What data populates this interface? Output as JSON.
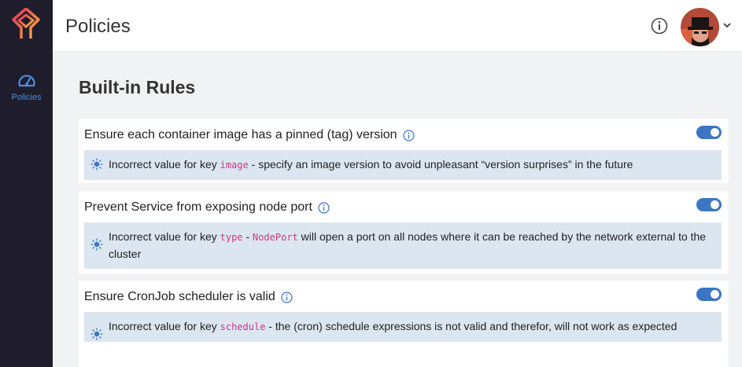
{
  "app": {
    "page_title": "Policies",
    "nav": [
      {
        "label": "Policies",
        "icon": "dashboard-icon",
        "active": true
      }
    ]
  },
  "colors": {
    "accent": "#3b75c4",
    "sidebar": "#1f1d2b",
    "notice_bg": "#dce6f1",
    "code": "#d63384"
  },
  "main": {
    "section_title": "Built-in Rules",
    "rules": [
      {
        "title": "Ensure each container image has a pinned (tag) version",
        "enabled": true,
        "msg_before": "Incorrect value for key ",
        "key": "image",
        "msg_mid": " - specify an image version to avoid unpleasant “version surprises” in the future",
        "value": "",
        "msg_after": ""
      },
      {
        "title": "Prevent Service from exposing node port",
        "enabled": true,
        "msg_before": "Incorrect value for key ",
        "key": "type",
        "msg_mid": " - ",
        "value": "NodePort",
        "msg_after": " will open a port on all nodes where it can be reached by the network external to the cluster"
      },
      {
        "title": "Ensure CronJob scheduler is valid",
        "enabled": true,
        "msg_before": "Incorrect value for key ",
        "key": "schedule",
        "msg_mid": " - the (cron) schedule expressions is not valid and therefor, will not work as expected",
        "value": "",
        "msg_after": ""
      }
    ]
  }
}
